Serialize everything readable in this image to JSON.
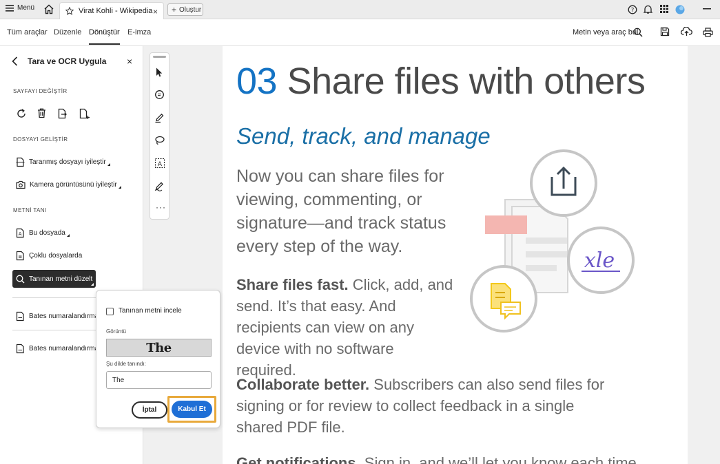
{
  "tabbar": {
    "menu_label": "Menü",
    "tab_title": "Virat Kohli - Wikipedia",
    "new_tab_label": "Oluştur",
    "accent": "#1f6fd6"
  },
  "toolbar": {
    "items": [
      "Tüm araçlar",
      "Düzenle",
      "Dönüştür",
      "E-imza"
    ],
    "active_item": "Dönüştür",
    "search_label": "Metin veya araç bul"
  },
  "left_panel": {
    "title": "Tara ve OCR Uygula",
    "section_page": "SAYFAYI DEĞİŞTİR",
    "section_enhance": "DOSYAYI GELİŞTİR",
    "enhance_items": [
      "Taranmış dosyayı iyileştir",
      "Kamera görüntüsünü iyileştir"
    ],
    "section_recognize": "METNİ TANI",
    "recognize_items": [
      "Bu dosyada",
      "Çoklu dosyalarda"
    ],
    "active_tool": "Tanınan metni düzelt",
    "bates_items": [
      "Bates numaralandırma",
      "Bates numaralandırma"
    ]
  },
  "popup": {
    "checkbox_label": "Tanınan metni incele",
    "image_label": "Görüntü",
    "image_text": "The",
    "language_label": "Şu dilde tanındı:",
    "input_value": "The",
    "cancel_label": "İptal",
    "accept_label": "Kabul Et",
    "highlight_color": "#e8a93b"
  },
  "document": {
    "heading_num": "03",
    "heading_text": " Share files with others",
    "subheading": "Send, track, and manage",
    "intro": "Now you can share files for viewing, commenting, or signature—and track status every step of the way.",
    "para1_bold": "Share files fast.",
    "para1_text": " Click, add, and send. It’s that easy. And recipients can view on any device with no software required.",
    "para2_bold": "Collaborate better.",
    "para2_text": " Subscribers can also send files for signing or for review to collect feedback in a single shared PDF file.",
    "para3_bold": "Get notifications.",
    "para3_text": " Sign in, and we’ll let you know each time",
    "sig_text": "xle",
    "brand_color": "#1473c4"
  }
}
